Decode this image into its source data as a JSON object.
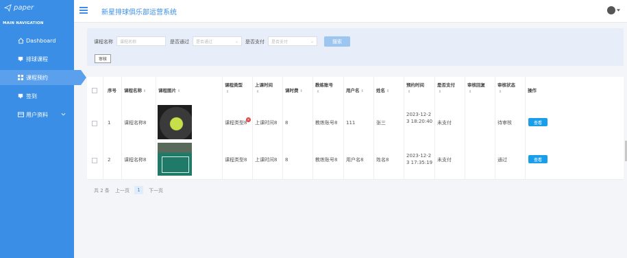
{
  "app": {
    "logo_text": "paper",
    "system_title": "新星排球俱乐部运营系统"
  },
  "sidebar": {
    "heading": "MAIN NAVIGATION",
    "items": [
      {
        "label": "Dashboard",
        "icon": "home-icon"
      },
      {
        "label": "排球课程",
        "icon": "screen-icon"
      },
      {
        "label": "课程预约",
        "icon": "grid-icon",
        "active": true
      },
      {
        "label": "签到",
        "icon": "screen-icon"
      },
      {
        "label": "用户资料",
        "icon": "card-icon",
        "expandable": true
      }
    ]
  },
  "filters": {
    "course_name_label": "课程名称",
    "course_name_placeholder": "课程名称",
    "approved_label": "是否通过",
    "approved_placeholder": "是否通过",
    "paid_label": "是否支付",
    "paid_placeholder": "是否支付",
    "search_label": "搜索",
    "audit_label": "审核"
  },
  "table": {
    "headers": [
      "序号",
      "课程名称",
      "课程图片",
      "课程类型",
      "上课时间",
      "课时费",
      "教练账号",
      "用户名",
      "姓名",
      "预约时间",
      "是否支付",
      "审核回复",
      "审核状态",
      "操作"
    ],
    "rows": [
      {
        "index": "1",
        "course_name": "课程名称8",
        "course_type": "课程类型8",
        "class_time": "上课时间8",
        "fee": "8",
        "coach_account": "教练账号8",
        "username": "111",
        "name": "张三",
        "booking_time": "2023-12-23 18:20:40",
        "paid": "未支付",
        "reply": "",
        "status": "待审核",
        "action": "查看"
      },
      {
        "index": "2",
        "course_name": "课程名称8",
        "course_type": "课程类型8",
        "class_time": "上课时间8",
        "fee": "8",
        "coach_account": "教练账号8",
        "username": "用户名8",
        "name": "姓名8",
        "booking_time": "2023-12-23 17:35:19",
        "paid": "未支付",
        "reply": "",
        "status": "通过",
        "action": "查看"
      }
    ]
  },
  "pager": {
    "total": "共 2 条",
    "prev": "上一页",
    "current": "1",
    "next": "下一页"
  }
}
